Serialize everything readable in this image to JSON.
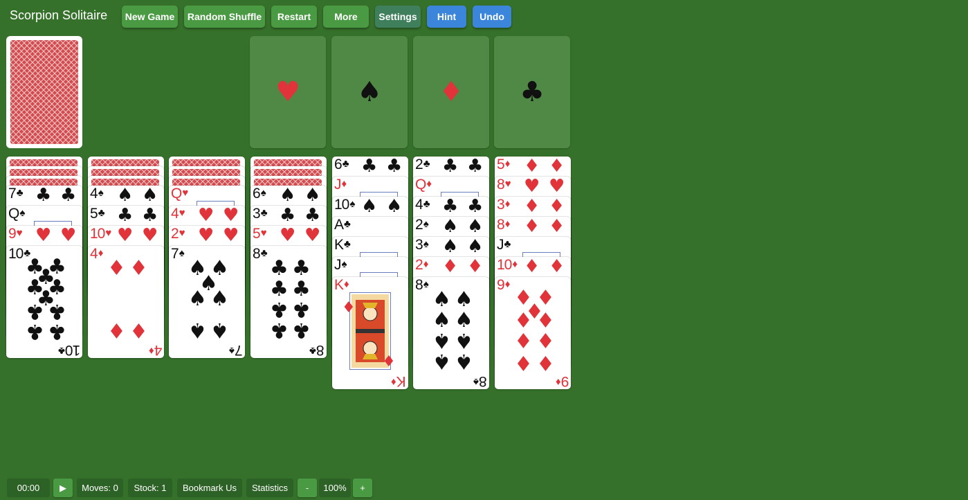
{
  "app": {
    "title": "Scorpion Solitaire",
    "background": "#36712b"
  },
  "toolbar": {
    "new_game": "New Game",
    "random_shuffle": "Random Shuffle",
    "restart": "Restart",
    "more": "More",
    "settings": "Settings",
    "hint": "Hint",
    "undo": "Undo"
  },
  "foundations": [
    "♥",
    "♠",
    "♦",
    "♣"
  ],
  "tableau": [
    {
      "down": 3,
      "up": [
        {
          "rank": "7",
          "suit": "♣"
        },
        {
          "rank": "Q",
          "suit": "♠"
        },
        {
          "rank": "9",
          "suit": "♥"
        },
        {
          "rank": "10",
          "suit": "♣"
        }
      ]
    },
    {
      "down": 3,
      "up": [
        {
          "rank": "4",
          "suit": "♠"
        },
        {
          "rank": "5",
          "suit": "♣"
        },
        {
          "rank": "10",
          "suit": "♥"
        },
        {
          "rank": "4",
          "suit": "♦"
        }
      ]
    },
    {
      "down": 3,
      "up": [
        {
          "rank": "Q",
          "suit": "♥"
        },
        {
          "rank": "4",
          "suit": "♥"
        },
        {
          "rank": "2",
          "suit": "♥"
        },
        {
          "rank": "7",
          "suit": "♠"
        }
      ]
    },
    {
      "down": 3,
      "up": [
        {
          "rank": "6",
          "suit": "♠"
        },
        {
          "rank": "3",
          "suit": "♣"
        },
        {
          "rank": "5",
          "suit": "♥"
        },
        {
          "rank": "8",
          "suit": "♣"
        }
      ]
    },
    {
      "down": 0,
      "up": [
        {
          "rank": "6",
          "suit": "♣"
        },
        {
          "rank": "J",
          "suit": "♦"
        },
        {
          "rank": "10",
          "suit": "♠"
        },
        {
          "rank": "A",
          "suit": "♣"
        },
        {
          "rank": "K",
          "suit": "♣"
        },
        {
          "rank": "J",
          "suit": "♠"
        },
        {
          "rank": "K",
          "suit": "♦"
        }
      ]
    },
    {
      "down": 0,
      "up": [
        {
          "rank": "2",
          "suit": "♣"
        },
        {
          "rank": "Q",
          "suit": "♦"
        },
        {
          "rank": "4",
          "suit": "♣"
        },
        {
          "rank": "2",
          "suit": "♠"
        },
        {
          "rank": "3",
          "suit": "♠"
        },
        {
          "rank": "2",
          "suit": "♦"
        },
        {
          "rank": "8",
          "suit": "♠"
        }
      ]
    },
    {
      "down": 0,
      "up": [
        {
          "rank": "5",
          "suit": "♦"
        },
        {
          "rank": "8",
          "suit": "♥"
        },
        {
          "rank": "3",
          "suit": "♦"
        },
        {
          "rank": "8",
          "suit": "♦"
        },
        {
          "rank": "J",
          "suit": "♣"
        },
        {
          "rank": "10",
          "suit": "♦"
        },
        {
          "rank": "9",
          "suit": "♦"
        }
      ]
    }
  ],
  "status": {
    "time": "00:00",
    "play_icon": "▶",
    "moves": "Moves: 0",
    "stock": "Stock: 1",
    "bookmark": "Bookmark Us",
    "statistics": "Statistics",
    "zoom_out": "-",
    "zoom": "100%",
    "zoom_in": "+"
  }
}
